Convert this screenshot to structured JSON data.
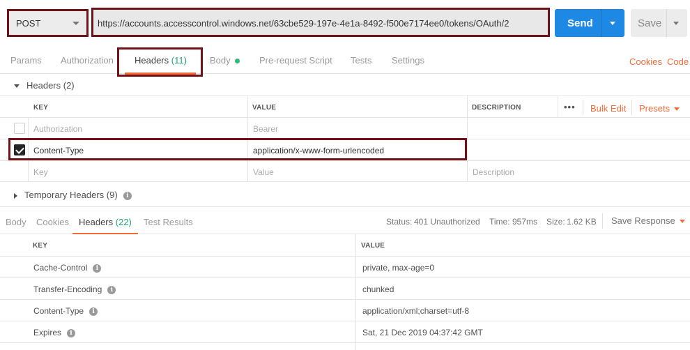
{
  "request": {
    "method": "POST",
    "url": "https://accounts.accesscontrol.windows.net/63cbe529-197e-4e1a-8492-f500e7174ee0/tokens/OAuth/2",
    "send_label": "Send",
    "save_label": "Save"
  },
  "request_tabs": {
    "params": "Params",
    "authorization": "Authorization",
    "headers": "Headers",
    "headers_count": "(11)",
    "body": "Body",
    "pre_request": "Pre-request Script",
    "tests": "Tests",
    "settings": "Settings",
    "cookies": "Cookies",
    "code": "Code"
  },
  "headers_section": {
    "title": "Headers (2)",
    "columns": {
      "key": "KEY",
      "value": "VALUE",
      "description": "DESCRIPTION"
    },
    "more": "•••",
    "bulk_edit": "Bulk Edit",
    "presets": "Presets",
    "rows": [
      {
        "key": "Authorization",
        "value": "Bearer",
        "checked": false
      },
      {
        "key": "Content-Type",
        "value": "application/x-www-form-urlencoded",
        "checked": true
      }
    ],
    "new_row": {
      "key": "Key",
      "value": "Value",
      "description": "Description"
    }
  },
  "temporary_headers": {
    "title": "Temporary Headers (9)"
  },
  "response_tabs": {
    "body": "Body",
    "cookies": "Cookies",
    "headers": "Headers",
    "headers_count": "(22)",
    "test_results": "Test Results",
    "status_label": "Status:",
    "status_value": "401 Unauthorized",
    "time_label": "Time:",
    "time_value": "957ms",
    "size_label": "Size:",
    "size_value": "1.62 KB",
    "save_response": "Save Response"
  },
  "response_headers": {
    "columns": {
      "key": "KEY",
      "value": "VALUE"
    },
    "rows": [
      {
        "key": "Cache-Control",
        "value": "private, max-age=0"
      },
      {
        "key": "Transfer-Encoding",
        "value": "chunked"
      },
      {
        "key": "Content-Type",
        "value": "application/xml;charset=utf-8"
      },
      {
        "key": "Expires",
        "value": "Sat, 21 Dec 2019 04:37:42 GMT"
      }
    ]
  },
  "colors": {
    "accent": "#f26b3a",
    "send": "#1e88e5",
    "success": "#1fa774",
    "highlight_border": "#6f1318"
  }
}
